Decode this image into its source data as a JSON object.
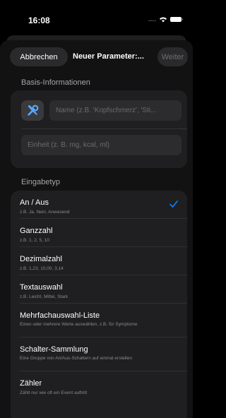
{
  "status_bar": {
    "time": "16:08",
    "dots": "...."
  },
  "nav": {
    "cancel": "Abbrechen",
    "title": "Neuer Parameter:...",
    "next": "Weiter"
  },
  "basis": {
    "title": "Basis-Informationen",
    "icon": "wrench-screwdriver-icon",
    "name_placeholder": "Name (z.B. 'Kopfschmerz', 'Sti...",
    "unit_placeholder": "Einheit (z. B. mg, kcal, ml)"
  },
  "eingabetyp": {
    "title": "Eingabetyp",
    "options": [
      {
        "label": "An / Aus",
        "description": "z.B. Ja, Nein, Anwesend",
        "selected": true
      },
      {
        "label": "Ganzzahl",
        "description": "z.B. 1, 2, 5, 10",
        "selected": false
      },
      {
        "label": "Dezimalzahl",
        "description": "z.B. 1,23, 10,00, 3,14",
        "selected": false
      },
      {
        "label": "Textauswahl",
        "description": "z.B. Leicht, Mittel, Stark",
        "selected": false
      },
      {
        "label": "Mehrfachauswahl-Liste",
        "description": "Einen oder mehrere Werte auswählen, z.B. für Symptome",
        "selected": false
      },
      {
        "label": "Schalter-Sammlung",
        "description": "Eine Gruppe von An/Aus-Schaltern auf einmal erstellen",
        "selected": false
      },
      {
        "label": "Zähler",
        "description": "Zählt nur wie oft ein Event auftritt",
        "selected": false
      }
    ]
  },
  "colors": {
    "accent": "#0a84ff",
    "icon_blue": "#5aa9ff"
  }
}
